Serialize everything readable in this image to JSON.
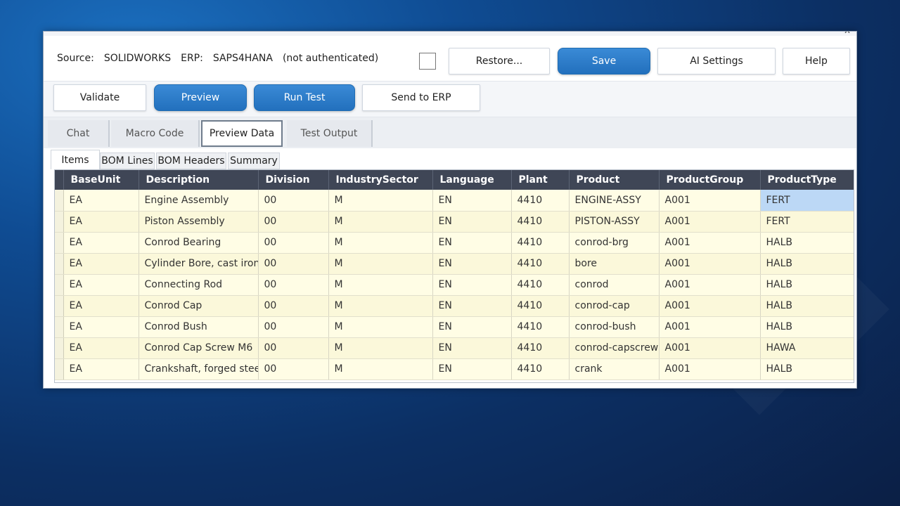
{
  "header": {
    "source_label": "Source:",
    "source_value": "SOLIDWORKS",
    "erp_label": "ERP:",
    "erp_value": "SAPS4HANA",
    "auth_status": "(not authenticated)"
  },
  "top_buttons": {
    "restore": "Restore...",
    "save": "Save",
    "ai_settings": "AI Settings",
    "help": "Help"
  },
  "actions": {
    "validate": "Validate",
    "preview": "Preview",
    "run_test": "Run Test",
    "send_to_erp": "Send to ERP"
  },
  "tabs": [
    "Chat",
    "Macro Code",
    "Preview Data",
    "Test Output"
  ],
  "subtabs": [
    "Items",
    "BOM Lines",
    "BOM Headers",
    "Summary"
  ],
  "grid": {
    "columns": [
      "BaseUnit",
      "Description",
      "Division",
      "IndustrySector",
      "Language",
      "Plant",
      "Product",
      "ProductGroup",
      "ProductType"
    ],
    "rows": [
      [
        "EA",
        "Engine Assembly",
        "00",
        "M",
        "EN",
        "4410",
        "ENGINE-ASSY",
        "A001",
        "FERT"
      ],
      [
        "EA",
        "Piston Assembly",
        "00",
        "M",
        "EN",
        "4410",
        "PISTON-ASSY",
        "A001",
        "FERT"
      ],
      [
        "EA",
        "Conrod Bearing",
        "00",
        "M",
        "EN",
        "4410",
        "conrod-brg",
        "A001",
        "HALB"
      ],
      [
        "EA",
        "Cylinder Bore, cast iron",
        "00",
        "M",
        "EN",
        "4410",
        "bore",
        "A001",
        "HALB"
      ],
      [
        "EA",
        "Connecting Rod",
        "00",
        "M",
        "EN",
        "4410",
        "conrod",
        "A001",
        "HALB"
      ],
      [
        "EA",
        "Conrod Cap",
        "00",
        "M",
        "EN",
        "4410",
        "conrod-cap",
        "A001",
        "HALB"
      ],
      [
        "EA",
        "Conrod Bush",
        "00",
        "M",
        "EN",
        "4410",
        "conrod-bush",
        "A001",
        "HALB"
      ],
      [
        "EA",
        "Conrod Cap Screw M6",
        "00",
        "M",
        "EN",
        "4410",
        "conrod-capscrew",
        "A001",
        "HAWA"
      ],
      [
        "EA",
        "Crankshaft, forged steel",
        "00",
        "M",
        "EN",
        "4410",
        "crank",
        "A001",
        "HALB"
      ]
    ]
  },
  "colors": {
    "primary_button": "#2a7cc7",
    "grid_header": "#3f4656",
    "row_fill": "#fffde5",
    "selection": "#bcd8f6"
  }
}
